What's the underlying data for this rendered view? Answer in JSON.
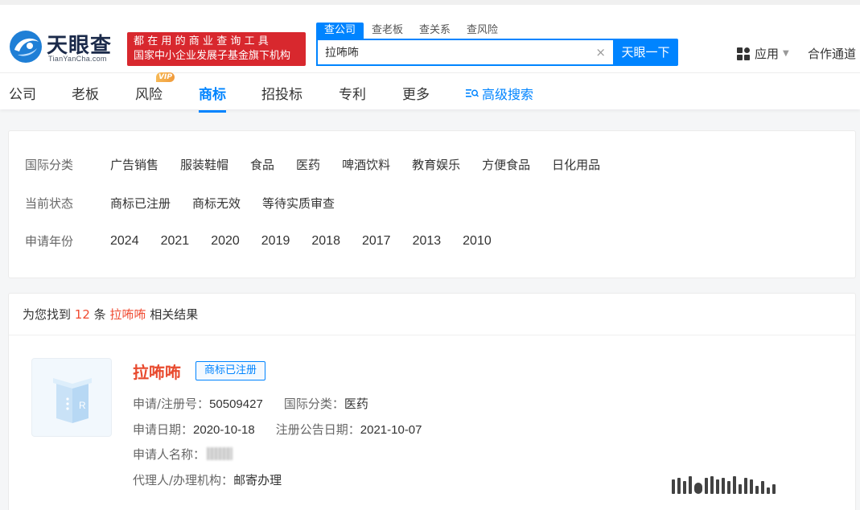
{
  "header": {
    "logo_name": "天眼查",
    "logo_sub": "TianYanCha.com",
    "banner_line1": "都在用的商业查询工具",
    "banner_line2": "国家中小企业发展子基金旗下机构",
    "search_tabs": [
      {
        "label": "查公司"
      },
      {
        "label": "查老板"
      },
      {
        "label": "查关系"
      },
      {
        "label": "查风险"
      }
    ],
    "search_value": "拉咘咘",
    "clear_glyph": "×",
    "search_button": "天眼一下",
    "apps_label": "应用",
    "partner_label": "合作通道"
  },
  "nav": {
    "items": [
      {
        "label": "公司"
      },
      {
        "label": "老板"
      },
      {
        "label": "风险"
      },
      {
        "label": "商标"
      },
      {
        "label": "招投标"
      },
      {
        "label": "专利"
      },
      {
        "label": "更多"
      }
    ],
    "vip_badge": "VIP",
    "advanced_search": "高级搜索",
    "active_tab": "商标"
  },
  "filters": {
    "rows": [
      {
        "label": "国际分类",
        "options": [
          "广告销售",
          "服装鞋帽",
          "食品",
          "医药",
          "啤酒饮料",
          "教育娱乐",
          "方便食品",
          "日化用品"
        ]
      },
      {
        "label": "当前状态",
        "options": [
          "商标已注册",
          "商标无效",
          "等待实质审查"
        ]
      },
      {
        "label": "申请年份",
        "options": [
          "2024",
          "2021",
          "2020",
          "2019",
          "2018",
          "2017",
          "2013",
          "2010"
        ]
      }
    ]
  },
  "results": {
    "prefix": "为您找到",
    "count": "12",
    "unit": "条",
    "keyword": "拉咘咘",
    "suffix": "相关结果",
    "items": [
      {
        "name": "拉咘咘",
        "status": "商标已注册",
        "reg_no_label": "申请/注册号：",
        "reg_no": "50509427",
        "class_label": "国际分类：",
        "class_value": "医药",
        "apply_date_label": "申请日期：",
        "apply_date": "2020-10-18",
        "publish_date_label": "注册公告日期：",
        "publish_date": "2021-10-07",
        "applicant_label": "申请人名称：",
        "agent_label": "代理人/办理机构：",
        "agent_value": "邮寄办理"
      }
    ]
  },
  "colors": {
    "brand_blue": "#0084ff",
    "highlight_red": "#e84a2e",
    "banner_red": "#d8282e"
  }
}
